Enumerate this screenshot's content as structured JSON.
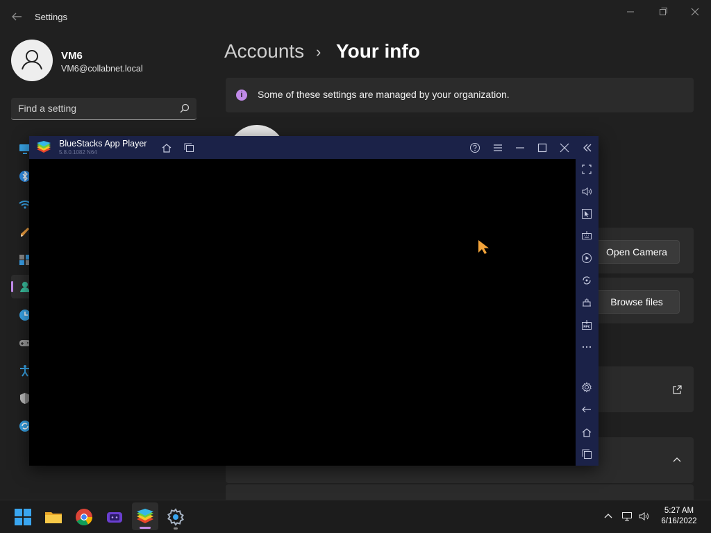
{
  "settings": {
    "app_title": "Settings",
    "user": {
      "name": "VM6",
      "email": "VM6@collabnet.local"
    },
    "search": {
      "placeholder": "Find a setting",
      "value": ""
    },
    "breadcrumb": {
      "parent": "Accounts",
      "separator": "›",
      "current": "Your info"
    },
    "banner": {
      "icon": "info-icon",
      "text": "Some of these settings are managed by your organization."
    },
    "buttons": {
      "open_camera": "Open Camera",
      "browse_files": "Browse files"
    },
    "nav_icons": [
      "system-icon",
      "bluetooth-icon",
      "network-icon",
      "personalization-icon",
      "apps-icon",
      "accounts-icon",
      "time-language-icon",
      "gaming-icon",
      "accessibility-icon",
      "privacy-security-icon",
      "windows-update-icon"
    ],
    "selected_nav": "accounts-icon"
  },
  "bluestacks": {
    "title": "BlueStacks App Player",
    "version": "5.8.0.1082 N64",
    "toolbar_icons": [
      "home-icon",
      "multi-instance-icon",
      "help-icon",
      "menu-icon",
      "minimize-icon",
      "maximize-icon",
      "close-icon",
      "collapse-sidebar-icon"
    ],
    "sidebar_icons": [
      "fullscreen-icon",
      "volume-icon",
      "pointer-icon",
      "keyboard-icon",
      "macro-icon",
      "rotate-icon",
      "eco-mode-icon",
      "install-apk-icon",
      "more-icon",
      "settings-icon",
      "back-icon",
      "home-icon",
      "recent-apps-icon"
    ]
  },
  "taskbar": {
    "apps": [
      "start-icon",
      "file-explorer-icon",
      "chrome-icon",
      "bluestacks-multi-instance-icon",
      "bluestacks-icon",
      "settings-icon"
    ],
    "active_app": "bluestacks-icon",
    "tray_icons": [
      "chevron-up-icon",
      "network-icon",
      "volume-icon"
    ],
    "time": "5:27 AM",
    "date": "6/16/2022"
  },
  "colors": {
    "accent": "#c08ae8",
    "background": "#202020",
    "card": "#2b2b2b",
    "bluestacks_frame": "#1b2248"
  }
}
